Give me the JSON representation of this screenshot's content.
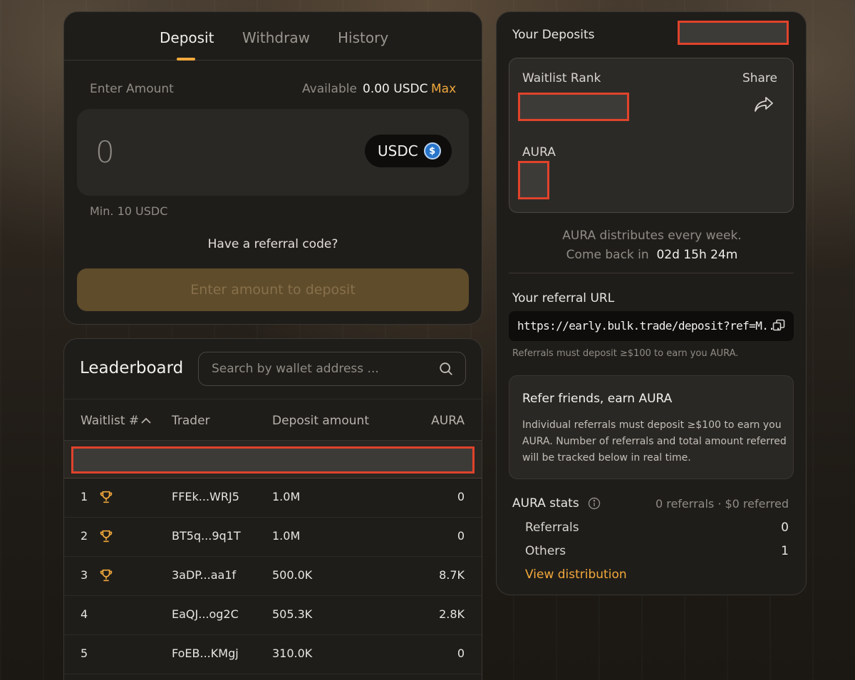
{
  "deposit": {
    "tabs": [
      {
        "label": "Deposit",
        "active": true
      },
      {
        "label": "Withdraw",
        "active": false
      },
      {
        "label": "History",
        "active": false
      }
    ],
    "enter_amount_label": "Enter Amount",
    "available_label": "Available",
    "available_value": "0.00 USDC",
    "max_label": "Max",
    "amount_value": "0",
    "token": "USDC",
    "token_icon": "usdc-icon",
    "min_label": "Min. 10 USDC",
    "referral_prompt": "Have a referral code?",
    "submit_label": "Enter amount to deposit",
    "accent_color": "#f2a93b"
  },
  "leaderboard": {
    "title": "Leaderboard",
    "search_placeholder": "Search by wallet address ...",
    "columns": {
      "waitlist": "Waitlist #",
      "trader": "Trader",
      "deposit": "Deposit amount",
      "aura": "AURA"
    },
    "rows": [
      {
        "rank": "1",
        "trophy": true,
        "trader": "FFEk...WRJ5",
        "deposit": "1.0M",
        "aura": "0"
      },
      {
        "rank": "2",
        "trophy": true,
        "trader": "BT5q...9q1T",
        "deposit": "1.0M",
        "aura": "0"
      },
      {
        "rank": "3",
        "trophy": true,
        "trader": "3aDP...aa1f",
        "deposit": "500.0K",
        "aura": "8.7K"
      },
      {
        "rank": "4",
        "trophy": false,
        "trader": "EaQJ...og2C",
        "deposit": "505.3K",
        "aura": "2.8K"
      },
      {
        "rank": "5",
        "trophy": false,
        "trader": "FoEB...KMgj",
        "deposit": "310.0K",
        "aura": "0"
      }
    ]
  },
  "your_deposits": {
    "title": "Your Deposits",
    "waitlist_rank_label": "Waitlist Rank",
    "share_label": "Share",
    "aura_label": "AURA",
    "dist_line1": "AURA distributes every week.",
    "dist_line2_prefix": "Come back in",
    "dist_countdown": "02d 15h 24m",
    "referral_url_label": "Your referral URL",
    "referral_url": "https://early.bulk.trade/deposit?ref=M...",
    "referral_note": "Referrals must deposit ≥$100 to earn you AURA.",
    "refer_card_title": "Refer friends, earn AURA",
    "refer_card_body": "Individual referrals must deposit ≥$100 to earn you AURA. Number of referrals and total amount referred will be tracked below in real time.",
    "stats_title": "AURA stats",
    "stats_summary": "0 referrals · $0 referred",
    "stats": [
      {
        "label": "Referrals",
        "value": "0"
      },
      {
        "label": "Others",
        "value": "1"
      }
    ],
    "view_distribution": "View distribution"
  }
}
